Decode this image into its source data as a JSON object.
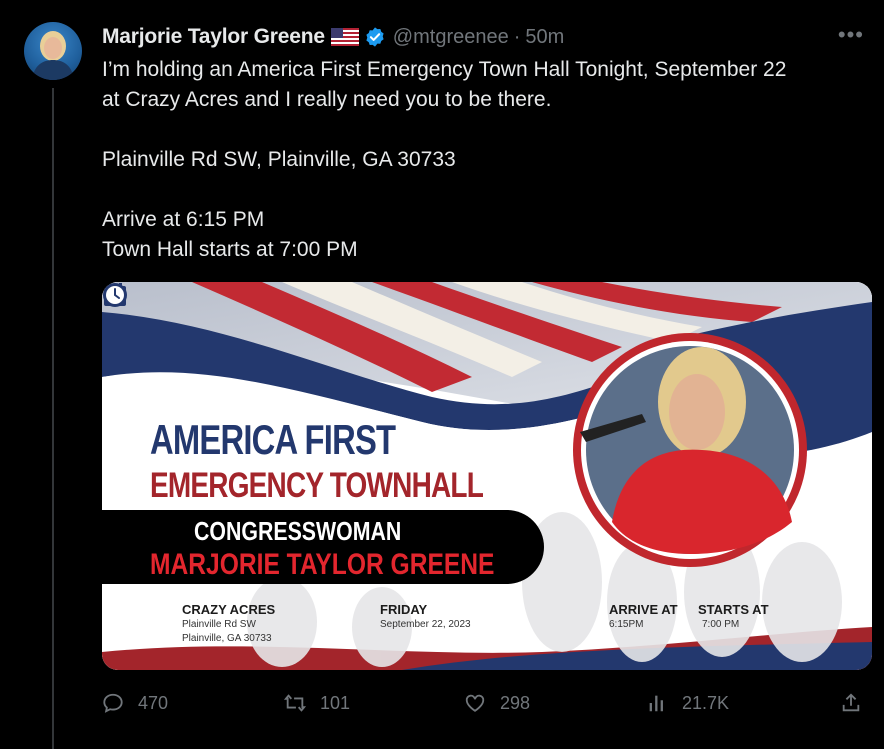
{
  "author": {
    "name": "Marjorie Taylor Greene",
    "handle": "@mtgreenee",
    "separator": "·",
    "time": "50m"
  },
  "more_label": "•••",
  "tweet": {
    "line1": "I’m holding an America First Emergency Town Hall Tonight, September 22",
    "line2": "at Crazy Acres and I really need you to be there.",
    "address": "Plainville Rd SW, Plainville, GA 30733",
    "arrive": "Arrive at 6:15 PM",
    "starts": "Town Hall starts at 7:00 PM"
  },
  "flyer": {
    "title_line1": "AMERICA FIRST",
    "title_line2": "EMERGENCY TOWNHALL",
    "banner_line1": "CONGRESSWOMAN",
    "banner_line2": "MARJORIE TAYLOR GREENE",
    "venue_label": "CRAZY ACRES",
    "venue_line1": "Plainville Rd SW",
    "venue_line2": "Plainville, GA 30733",
    "day_label": "FRIDAY",
    "date": "September 22, 2023",
    "arrive_label": "ARRIVE AT",
    "arrive_time": "6:15PM",
    "starts_label": "STARTS AT",
    "starts_time": "7:00 PM",
    "colors": {
      "navy": "#23386e",
      "red": "#a3252b",
      "bright_red": "#e3262e"
    }
  },
  "actions": {
    "replies": "470",
    "reposts": "101",
    "likes": "298",
    "views": "21.7K"
  },
  "icons": [
    "reply-icon",
    "repost-icon",
    "like-icon",
    "views-icon",
    "share-icon",
    "verified-icon",
    "us-flag-icon",
    "more-icon"
  ],
  "colors": {
    "background": "#000000",
    "text": "#e7e9ea",
    "muted": "#71767b",
    "verified": "#1d9bf0"
  }
}
